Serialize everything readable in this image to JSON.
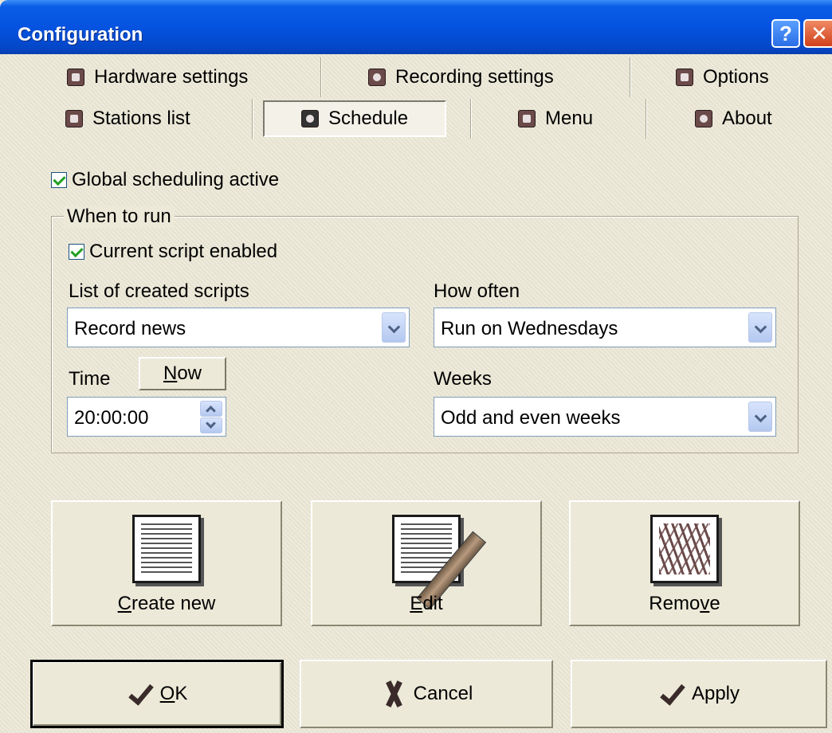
{
  "window": {
    "title": "Configuration",
    "help_label": "?",
    "close_label": "✕"
  },
  "tabs": {
    "row1": [
      {
        "label": "Hardware settings",
        "icon": "hardware-icon"
      },
      {
        "label": "Recording settings",
        "icon": "record-icon"
      },
      {
        "label": "Options",
        "icon": "options-icon"
      }
    ],
    "row2": [
      {
        "label": "Stations list",
        "icon": "stations-icon"
      },
      {
        "label": "Schedule",
        "icon": "clock-icon",
        "active": true
      },
      {
        "label": "Menu",
        "icon": "menu-icon"
      },
      {
        "label": "About",
        "icon": "about-icon"
      }
    ]
  },
  "schedule": {
    "global_active_label": "Global scheduling active",
    "global_active_checked": true,
    "group_title": "When to run",
    "script_enabled_label": "Current script enabled",
    "script_enabled_checked": true,
    "scripts_label": "List of created scripts",
    "scripts_value": "Record news",
    "how_often_label": "How often",
    "how_often_value": "Run on Wednesdays",
    "time_label": "Time",
    "now_button": {
      "mnemonic": "N",
      "rest": "ow"
    },
    "time_value": "20:00:00",
    "weeks_label": "Weeks",
    "weeks_value": "Odd and even weeks"
  },
  "actions": {
    "create": {
      "mnemonic": "C",
      "rest": "reate new"
    },
    "edit": {
      "mnemonic": "E",
      "rest": "dit"
    },
    "remove": {
      "before": "Remo",
      "mnemonic": "v",
      "after": "e"
    }
  },
  "footer": {
    "ok": {
      "mnemonic": "O",
      "rest": "K"
    },
    "cancel": "Cancel",
    "apply": "Apply"
  }
}
